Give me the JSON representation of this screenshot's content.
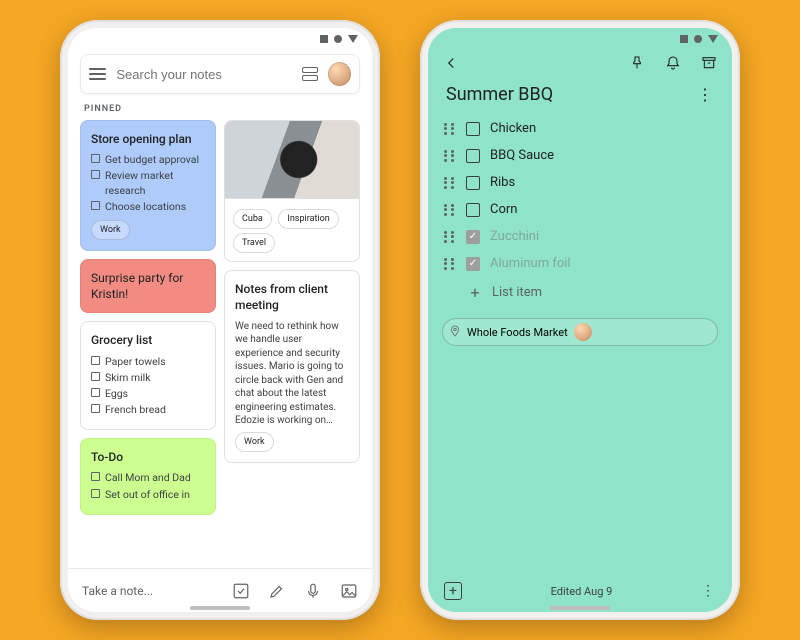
{
  "left": {
    "search_placeholder": "Search your notes",
    "pinned_label": "PINNED",
    "notes": {
      "store": {
        "title": "Store opening plan",
        "items": [
          "Get budget approval",
          "Review market research",
          "Choose locations"
        ],
        "chip": "Work",
        "color": "#aecbfa"
      },
      "surprise": {
        "text": "Surprise party for Kristin!",
        "color": "#f28b82"
      },
      "grocery": {
        "title": "Grocery list",
        "items": [
          "Paper towels",
          "Skim milk",
          "Eggs",
          "French bread"
        ]
      },
      "todo": {
        "title": "To-Do",
        "items": [
          "Call Mom and Dad",
          "Set out of office in"
        ],
        "color": "#ccff90"
      },
      "image_note": {
        "chips": [
          "Cuba",
          "Inspiration",
          "Travel"
        ]
      },
      "client": {
        "title": "Notes from client meeting",
        "body": "We need to rethink how we handle user experience and security issues. Mario is going to circle back with Gen and chat about the latest engineering estimates. Edozie is working on…",
        "chip": "Work"
      }
    },
    "take_note": "Take a note..."
  },
  "right": {
    "title": "Summer BBQ",
    "items": [
      {
        "label": "Chicken",
        "done": false
      },
      {
        "label": "BBQ Sauce",
        "done": false
      },
      {
        "label": "Ribs",
        "done": false
      },
      {
        "label": "Corn",
        "done": false
      },
      {
        "label": "Zucchini",
        "done": true
      },
      {
        "label": "Aluminum foil",
        "done": true
      }
    ],
    "add_item": "List item",
    "location": "Whole Foods Market",
    "edited": "Edited Aug 9"
  }
}
